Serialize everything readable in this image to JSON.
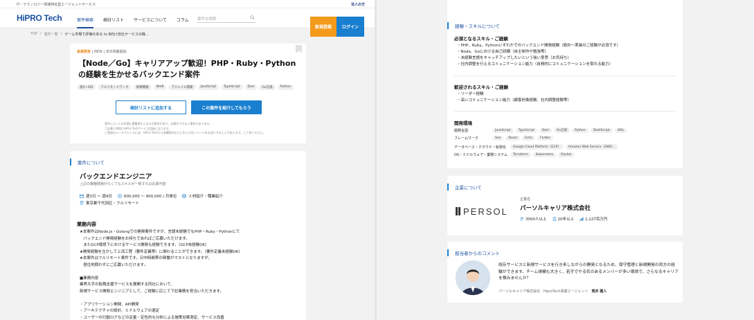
{
  "topbar": {
    "tagline": "IT・テクノロジー領域特化型エージェントサービス",
    "corporate": "法人の方"
  },
  "header": {
    "logo_main": "HiPRO Tech",
    "nav": [
      "案件検索",
      "検討リスト",
      "サービスについて",
      "コラム"
    ],
    "search_placeholder": "案件を検索",
    "register": "新規登録",
    "login": "ログイン"
  },
  "breadcrumb": [
    "TOP",
    "/",
    "案件一覧",
    "/",
    "ゲーム市場で評価のある to B向け自社サービスの機..."
  ],
  "job": {
    "badge": "会員限定",
    "badge_rest": "| NEW | 本日掲載開始",
    "title": "【Node／Go】キャリアアップ歓迎！PHP・Ruby・Pythonの経験を生かせるバックエンド案件",
    "tags": [
      "週3〜4日",
      "フルリモートワーク",
      "新規開発",
      "BtoB",
      "アジャイル開発",
      "JavaScript",
      "TypeScript",
      "Dart",
      "Go言語",
      "Python"
    ],
    "btn_list": "検討リストに追加する",
    "btn_intro": "この案件を紹介してもらう",
    "notes": [
      "案件によっては早期に募集停止となる可能性があり、応募ができない場合もあります。",
      "ご応募と同時にHiPro Techサービス会員となります。",
      "ご登録のメールアドレスには、HiPro Techから各種案内などに生じせ出ソメールをお送りすることがあります。ご了承ください。"
    ]
  },
  "about": {
    "heading": "案件について",
    "position": "バックエンドエンジニア",
    "sub": "上記の職種経験がなくてもスキルが一致すれば応募可能",
    "days": "週3日 〜 週4日",
    "pay": "600,000 〜 900,000 / 月単位",
    "type": "人材紹介・職業紹介",
    "location": "東京都千代田区・フルリモート",
    "biz_heading": "業務内容",
    "body": "★本案件はNode.js・Golangでの開発案件ですが、言語未経験でもPHP・Ruby・Pythonにて\n   バックエンド開発経験をお持ちであればご応募いただけます。\n   またGCP環境下におけるサービス開発も経験できます。（GCP未経験OK）\n★開発経験を生かして上流工程（要件定義等）に関わることができます。（要件定義未経験OK）\n★本案件はフルリモート案件です。日中時間帯の稼働がマストとなりますが、\n   居住地問わずにご応募いただけます。\n\n■業務内容\n業界大手の転職支援サービスを展開する同社において、\n新規サービス開発エンジニアとして、ご経験に応じて下記業務を担当いただきます。\n\n・アプリケーション開発、API開発\n・アーキテクチャの設計、ミドルウェアの選定\n・ユーザーの行動ログなどの定量・定性的な分析による施策効果測定、サービス改善\n・企画者の初期段階（DesignSprint を始めとしたサービス設計を実施中）"
  },
  "skills": {
    "heading": "経験・スキルについて",
    "required_heading": "必須となるスキル・ご経験",
    "required": "・PHP、Ruby、Pythonいずれかでのバックエンド開発経験（設計〜実装のご経験が必須です）\n・Node、Goにおける自己研鑽（自主制作や勉強等）\n・未経験言語をキャッチアップしたいという強い意思（お気持ち）\n・社内調整を行えるコミュニケーション能力（自発的にコミュニケーションを取れる能力）",
    "welcome_heading": "歓迎されるスキル・ご経験",
    "welcome": "・リーダー経験\n・高いコミュニケーション能力（顧客折衝経験、社内調整経験等）",
    "env_heading": "開発環境",
    "env": [
      {
        "label": "開発言語",
        "items": [
          "JavaScript",
          "TypeScript",
          "Dart",
          "Go言語",
          "Python",
          "ShellScript",
          "HDL"
        ]
      },
      {
        "label": "フレームワーク",
        "items": [
          "Vue",
          "React",
          "Echo",
          "Flutter"
        ]
      },
      {
        "label": "データベース・クラウド・仮想化",
        "items": [
          "Google Cloud Platform（GCP）",
          "Amazon Web Service（AWS）"
        ]
      },
      {
        "label": "OS・ミドルウェア・業務システム",
        "items": [
          "Terraform",
          "Kubernetes",
          "Docker"
        ]
      }
    ]
  },
  "company": {
    "heading": "企業について",
    "logo_text": "PERSOL",
    "label": "企業名",
    "name": "パーソルキャリア株式会社",
    "employees": "3000人以上",
    "years": "20年以上",
    "capital": "1,127百万円"
  },
  "comment": {
    "heading": "担当者からのコメント",
    "text": "既存サービスと新規サービスを行き来しながらの開発となるため、保守管理と新規開発の両方の経験ができます。チーム規模も大きく、若手でやる気のあるメンバーが多い環境で、さらなるキャリアを積みませんか？",
    "company": "パーソルキャリア株式会社　HiproTech事業エージェント",
    "name": "荒井 雅人"
  }
}
